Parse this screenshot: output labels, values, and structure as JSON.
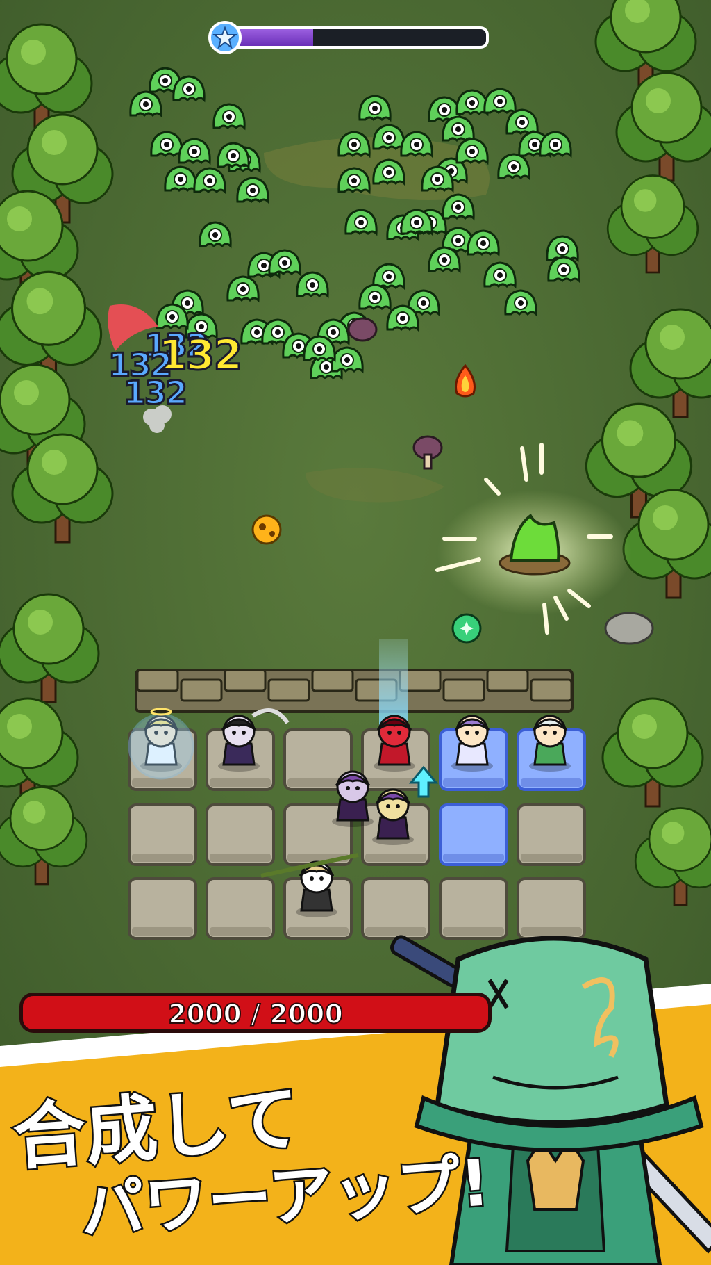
{
  "wave_progress": 0.33,
  "wave_star_icon": "star-icon",
  "colors": {
    "grass": "#4a6a33",
    "path": "#6a7a3a",
    "wall": "#7a7356",
    "tile": "#b8b29e",
    "tile_lit": "#8fb0ff",
    "hp_red": "#d10f17",
    "banner_yellow": "#f3b21a",
    "wave_purple": "#7b3fd0",
    "slime_green": "#5fd05a"
  },
  "damage_numbers": {
    "blue_1": "132",
    "blue_2": "132",
    "blue_3": "132",
    "yellow": "132"
  },
  "player_hp": {
    "current": 2000,
    "max": 2000,
    "text": "2000 / 2000"
  },
  "headline": {
    "line1": "合成して",
    "line2": "パワーアップ!"
  },
  "grid": {
    "rows": 3,
    "cols": 6,
    "lit_tiles": [
      [
        0,
        4
      ],
      [
        0,
        5
      ],
      [
        1,
        4
      ]
    ]
  },
  "units": [
    {
      "name": "angel-hero",
      "icon": "angel-icon"
    },
    {
      "name": "reaper-hero",
      "icon": "reaper-icon"
    },
    {
      "name": "red-mage-hero",
      "icon": "mage-icon"
    },
    {
      "name": "purple-cleric-hero",
      "icon": "cleric-icon"
    },
    {
      "name": "elf-hero",
      "icon": "elf-icon"
    },
    {
      "name": "imp-hero-1",
      "icon": "imp-icon"
    },
    {
      "name": "imp-hero-2",
      "icon": "imp-icon"
    },
    {
      "name": "panda-samurai-hero",
      "icon": "panda-icon"
    }
  ]
}
